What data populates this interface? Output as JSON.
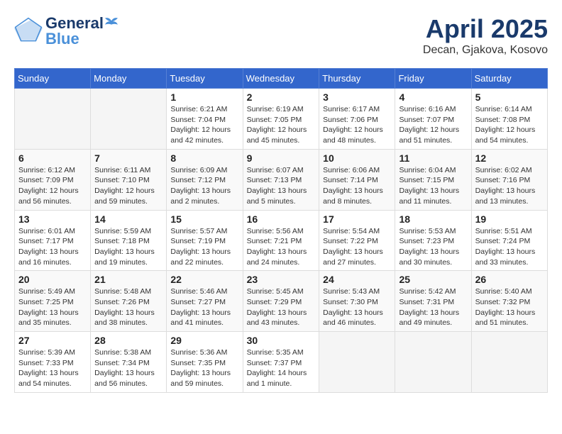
{
  "header": {
    "logo_line1": "General",
    "logo_line2": "Blue",
    "month_title": "April 2025",
    "location": "Decan, Gjakova, Kosovo"
  },
  "days_of_week": [
    "Sunday",
    "Monday",
    "Tuesday",
    "Wednesday",
    "Thursday",
    "Friday",
    "Saturday"
  ],
  "weeks": [
    [
      {
        "day": "",
        "info": ""
      },
      {
        "day": "",
        "info": ""
      },
      {
        "day": "1",
        "info": "Sunrise: 6:21 AM\nSunset: 7:04 PM\nDaylight: 12 hours and 42 minutes."
      },
      {
        "day": "2",
        "info": "Sunrise: 6:19 AM\nSunset: 7:05 PM\nDaylight: 12 hours and 45 minutes."
      },
      {
        "day": "3",
        "info": "Sunrise: 6:17 AM\nSunset: 7:06 PM\nDaylight: 12 hours and 48 minutes."
      },
      {
        "day": "4",
        "info": "Sunrise: 6:16 AM\nSunset: 7:07 PM\nDaylight: 12 hours and 51 minutes."
      },
      {
        "day": "5",
        "info": "Sunrise: 6:14 AM\nSunset: 7:08 PM\nDaylight: 12 hours and 54 minutes."
      }
    ],
    [
      {
        "day": "6",
        "info": "Sunrise: 6:12 AM\nSunset: 7:09 PM\nDaylight: 12 hours and 56 minutes."
      },
      {
        "day": "7",
        "info": "Sunrise: 6:11 AM\nSunset: 7:10 PM\nDaylight: 12 hours and 59 minutes."
      },
      {
        "day": "8",
        "info": "Sunrise: 6:09 AM\nSunset: 7:12 PM\nDaylight: 13 hours and 2 minutes."
      },
      {
        "day": "9",
        "info": "Sunrise: 6:07 AM\nSunset: 7:13 PM\nDaylight: 13 hours and 5 minutes."
      },
      {
        "day": "10",
        "info": "Sunrise: 6:06 AM\nSunset: 7:14 PM\nDaylight: 13 hours and 8 minutes."
      },
      {
        "day": "11",
        "info": "Sunrise: 6:04 AM\nSunset: 7:15 PM\nDaylight: 13 hours and 11 minutes."
      },
      {
        "day": "12",
        "info": "Sunrise: 6:02 AM\nSunset: 7:16 PM\nDaylight: 13 hours and 13 minutes."
      }
    ],
    [
      {
        "day": "13",
        "info": "Sunrise: 6:01 AM\nSunset: 7:17 PM\nDaylight: 13 hours and 16 minutes."
      },
      {
        "day": "14",
        "info": "Sunrise: 5:59 AM\nSunset: 7:18 PM\nDaylight: 13 hours and 19 minutes."
      },
      {
        "day": "15",
        "info": "Sunrise: 5:57 AM\nSunset: 7:19 PM\nDaylight: 13 hours and 22 minutes."
      },
      {
        "day": "16",
        "info": "Sunrise: 5:56 AM\nSunset: 7:21 PM\nDaylight: 13 hours and 24 minutes."
      },
      {
        "day": "17",
        "info": "Sunrise: 5:54 AM\nSunset: 7:22 PM\nDaylight: 13 hours and 27 minutes."
      },
      {
        "day": "18",
        "info": "Sunrise: 5:53 AM\nSunset: 7:23 PM\nDaylight: 13 hours and 30 minutes."
      },
      {
        "day": "19",
        "info": "Sunrise: 5:51 AM\nSunset: 7:24 PM\nDaylight: 13 hours and 33 minutes."
      }
    ],
    [
      {
        "day": "20",
        "info": "Sunrise: 5:49 AM\nSunset: 7:25 PM\nDaylight: 13 hours and 35 minutes."
      },
      {
        "day": "21",
        "info": "Sunrise: 5:48 AM\nSunset: 7:26 PM\nDaylight: 13 hours and 38 minutes."
      },
      {
        "day": "22",
        "info": "Sunrise: 5:46 AM\nSunset: 7:27 PM\nDaylight: 13 hours and 41 minutes."
      },
      {
        "day": "23",
        "info": "Sunrise: 5:45 AM\nSunset: 7:29 PM\nDaylight: 13 hours and 43 minutes."
      },
      {
        "day": "24",
        "info": "Sunrise: 5:43 AM\nSunset: 7:30 PM\nDaylight: 13 hours and 46 minutes."
      },
      {
        "day": "25",
        "info": "Sunrise: 5:42 AM\nSunset: 7:31 PM\nDaylight: 13 hours and 49 minutes."
      },
      {
        "day": "26",
        "info": "Sunrise: 5:40 AM\nSunset: 7:32 PM\nDaylight: 13 hours and 51 minutes."
      }
    ],
    [
      {
        "day": "27",
        "info": "Sunrise: 5:39 AM\nSunset: 7:33 PM\nDaylight: 13 hours and 54 minutes."
      },
      {
        "day": "28",
        "info": "Sunrise: 5:38 AM\nSunset: 7:34 PM\nDaylight: 13 hours and 56 minutes."
      },
      {
        "day": "29",
        "info": "Sunrise: 5:36 AM\nSunset: 7:35 PM\nDaylight: 13 hours and 59 minutes."
      },
      {
        "day": "30",
        "info": "Sunrise: 5:35 AM\nSunset: 7:37 PM\nDaylight: 14 hours and 1 minute."
      },
      {
        "day": "",
        "info": ""
      },
      {
        "day": "",
        "info": ""
      },
      {
        "day": "",
        "info": ""
      }
    ]
  ]
}
